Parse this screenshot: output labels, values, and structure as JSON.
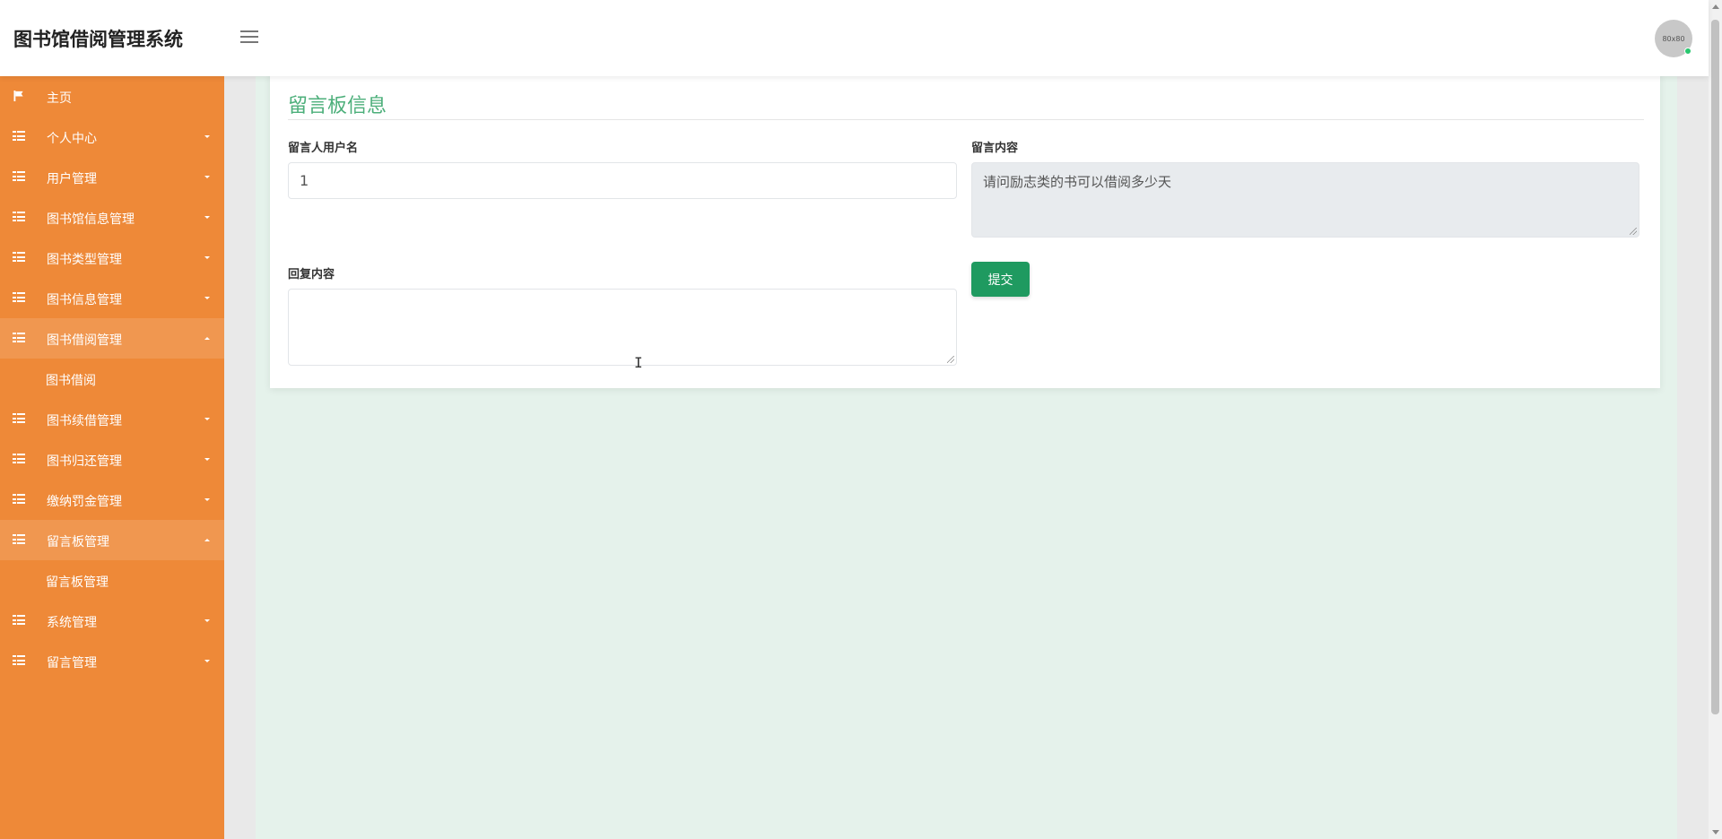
{
  "app": {
    "title": "图书馆借阅管理系统"
  },
  "header": {
    "avatar_text": "80x80"
  },
  "sidebar": {
    "items": [
      {
        "label": "主页",
        "icon": "flag-icon"
      },
      {
        "label": "个人中心",
        "icon": "grid-icon"
      },
      {
        "label": "用户管理",
        "icon": "grid-icon"
      },
      {
        "label": "图书馆信息管理",
        "icon": "grid-icon"
      },
      {
        "label": "图书类型管理",
        "icon": "grid-icon"
      },
      {
        "label": "图书信息管理",
        "icon": "grid-icon"
      },
      {
        "label": "图书借阅管理",
        "icon": "grid-icon",
        "expanded": true,
        "children": [
          "图书借阅"
        ]
      },
      {
        "label": "图书续借管理",
        "icon": "grid-icon"
      },
      {
        "label": "图书归还管理",
        "icon": "grid-icon"
      },
      {
        "label": "缴纳罚金管理",
        "icon": "grid-icon"
      },
      {
        "label": "留言板管理",
        "icon": "grid-icon",
        "expanded": true,
        "children": [
          "留言板管理"
        ]
      },
      {
        "label": "系统管理",
        "icon": "grid-icon"
      },
      {
        "label": "留言管理",
        "icon": "grid-icon"
      }
    ]
  },
  "form": {
    "title": "留言板信息",
    "username_label": "留言人用户名",
    "username_value": "1",
    "content_label": "留言内容",
    "content_value": "请问励志类的书可以借阅多少天",
    "reply_label": "回复内容",
    "reply_value": "",
    "submit_label": "提交"
  },
  "colors": {
    "sidebar_bg": "#ee8938",
    "sidebar_active": "#f09750",
    "accent_green": "#1f9a60",
    "title_green": "#4caf7a",
    "content_bg": "#e5f2eb"
  }
}
